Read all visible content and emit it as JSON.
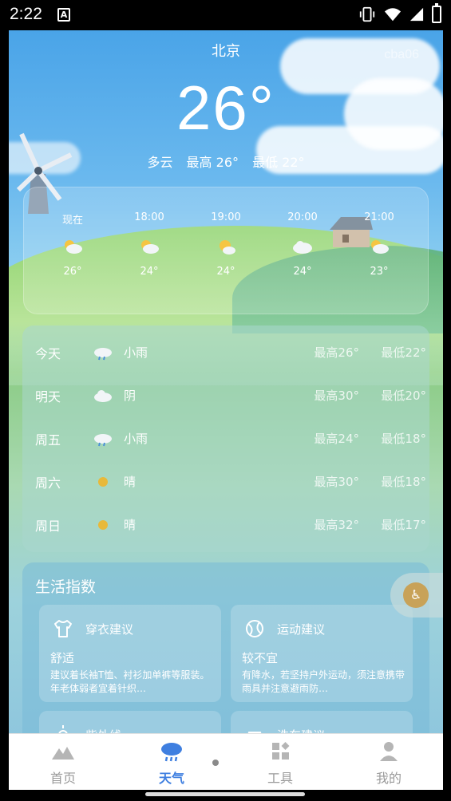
{
  "status": {
    "time": "2:22",
    "notification_letter": "A"
  },
  "header": {
    "city": "北京",
    "watermark": "cba06",
    "temperature": "26°",
    "condition": "多云",
    "high": "最高 26°",
    "low": "最低 22°"
  },
  "hourly": [
    {
      "time": "现在",
      "icon": "cloudy-sun-icon",
      "temp": "26°"
    },
    {
      "time": "18:00",
      "icon": "cloudy-sun-icon",
      "temp": "24°"
    },
    {
      "time": "19:00",
      "icon": "sun-cloud-icon",
      "temp": "24°"
    },
    {
      "time": "20:00",
      "icon": "cloud-icon",
      "temp": "24°"
    },
    {
      "time": "21:00",
      "icon": "cloudy-sun-icon",
      "temp": "23°"
    }
  ],
  "daily": [
    {
      "day": "今天",
      "icon": "rain-cloud-icon",
      "cond": "小雨",
      "high": "最高26°",
      "low": "最低22°"
    },
    {
      "day": "明天",
      "icon": "cloud-icon",
      "cond": "阴",
      "high": "最高30°",
      "low": "最低20°"
    },
    {
      "day": "周五",
      "icon": "rain-cloud-icon",
      "cond": "小雨",
      "high": "最高24°",
      "low": "最低18°"
    },
    {
      "day": "周六",
      "icon": "sun-icon",
      "cond": "晴",
      "high": "最高30°",
      "low": "最低18°"
    },
    {
      "day": "周日",
      "icon": "sun-icon",
      "cond": "晴",
      "high": "最高32°",
      "low": "最低17°"
    }
  ],
  "life": {
    "title": "生活指数",
    "tiles": [
      {
        "icon": "shirt-icon",
        "name": "穿衣建议",
        "level": "舒适",
        "desc": "建议着长袖T恤、衬衫加单裤等服装。年老体弱者宜着针织…"
      },
      {
        "icon": "ball-icon",
        "name": "运动建议",
        "level": "较不宜",
        "desc": "有降水，若坚持户外运动，须注意携带雨具并注意避雨防…"
      },
      {
        "icon": "sun-uv-icon",
        "name": "紫外线",
        "level": "",
        "desc": ""
      },
      {
        "icon": "car-icon",
        "name": "洗车建议",
        "level": "",
        "desc": ""
      }
    ]
  },
  "nav": [
    {
      "label": "首页",
      "icon": "mountain-icon",
      "active": false
    },
    {
      "label": "天气",
      "icon": "rain-cloud-icon",
      "active": true
    },
    {
      "label": "工具",
      "icon": "grid-icon",
      "active": false
    },
    {
      "label": "我的",
      "icon": "person-icon",
      "active": false
    }
  ],
  "colors": {
    "active_tab": "#3f7fe0",
    "inactive_tab": "#9a9a9a"
  }
}
